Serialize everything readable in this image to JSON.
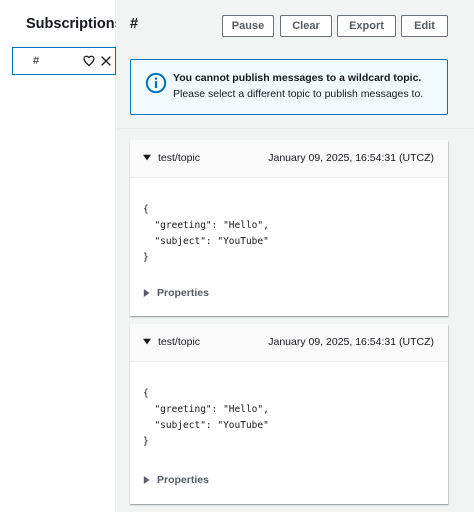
{
  "sidebar": {
    "title": "Subscriptions",
    "items": [
      {
        "label": "#",
        "icons": [
          "heart-icon",
          "close-icon"
        ]
      }
    ]
  },
  "main": {
    "topic_title": "#",
    "toolbar": {
      "pause_label": "Pause",
      "clear_label": "Clear",
      "export_label": "Export",
      "edit_label": "Edit"
    },
    "alert": {
      "title": "You cannot publish messages to a wildcard topic.",
      "body": "Please select a different topic to publish messages to.",
      "icon": "info-icon"
    },
    "messages": [
      {
        "topic": "test/topic",
        "timestamp": "January 09, 2025, 16:54:31 (UTCZ)",
        "payload": "{\n  \"greeting\": \"Hello\",\n  \"subject\": \"YouTube\"\n}",
        "properties_label": "Properties"
      },
      {
        "topic": "test/topic",
        "timestamp": "January 09, 2025, 16:54:31 (UTCZ)",
        "payload": "{\n  \"greeting\": \"Hello\",\n  \"subject\": \"YouTube\"\n}",
        "properties_label": "Properties"
      }
    ]
  },
  "colors": {
    "accent": "#0073bb",
    "alert_bg": "#f1faff",
    "panel_bg": "#f2f3f3",
    "text": "#16191f",
    "muted": "#545b64"
  }
}
